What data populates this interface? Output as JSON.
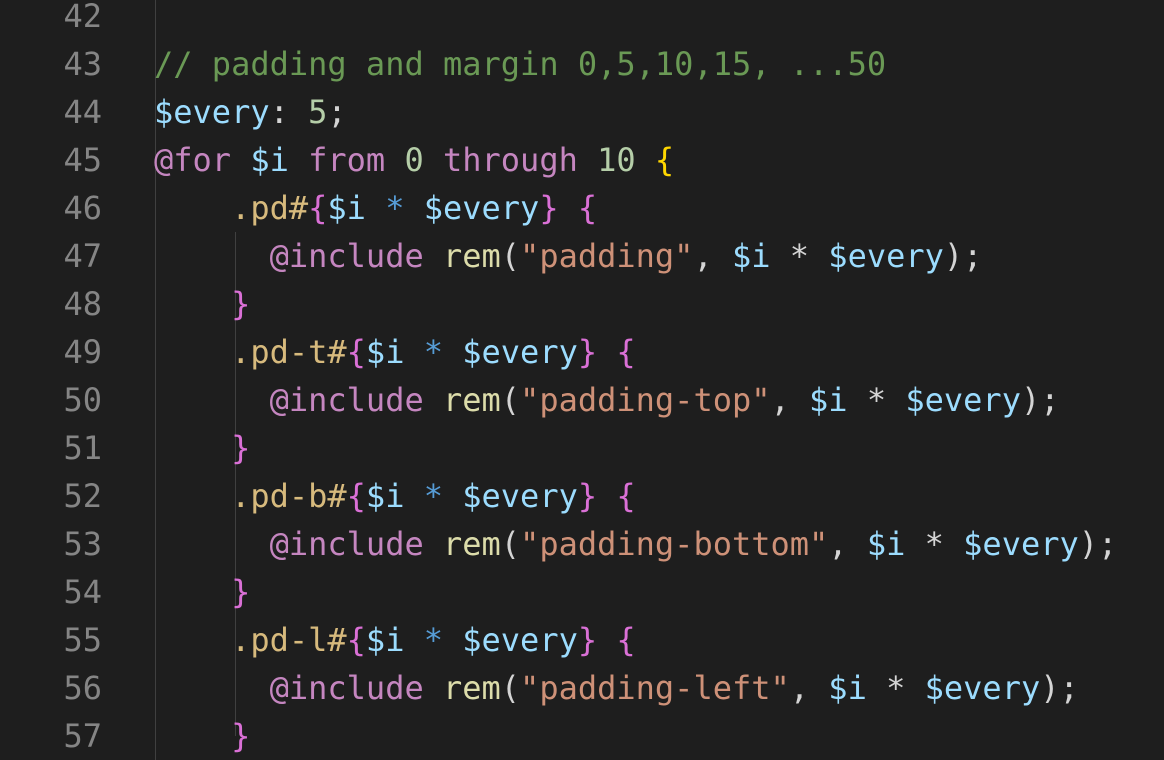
{
  "editor": {
    "colors": {
      "background": "#1e1e1e",
      "line_number": "#858585",
      "comment": "#6a9955",
      "variable": "#9cdcfe",
      "number": "#b5cea8",
      "keyword": "#c586c0",
      "bracket_level1": "#ffd700",
      "bracket_level2": "#da70d6",
      "selector": "#d7ba7d",
      "function": "#dcdcaa",
      "string": "#ce9178",
      "operator": "#569cd6"
    },
    "lines": [
      {
        "number": "42",
        "tokens": []
      },
      {
        "number": "43",
        "tokens": [
          {
            "text": "// padding and margin 0,5,10,15, ...50",
            "type": "comment"
          }
        ]
      },
      {
        "number": "44",
        "tokens": [
          {
            "text": "$every",
            "type": "var"
          },
          {
            "text": ": ",
            "type": "punc"
          },
          {
            "text": "5",
            "type": "num"
          },
          {
            "text": ";",
            "type": "punc"
          }
        ]
      },
      {
        "number": "45",
        "tokens": [
          {
            "text": "@for",
            "type": "kw"
          },
          {
            "text": " ",
            "type": "punc"
          },
          {
            "text": "$i",
            "type": "var"
          },
          {
            "text": " ",
            "type": "punc"
          },
          {
            "text": "from",
            "type": "kw"
          },
          {
            "text": " ",
            "type": "punc"
          },
          {
            "text": "0",
            "type": "num"
          },
          {
            "text": " ",
            "type": "punc"
          },
          {
            "text": "through",
            "type": "kw"
          },
          {
            "text": " ",
            "type": "punc"
          },
          {
            "text": "10",
            "type": "num"
          },
          {
            "text": " ",
            "type": "punc"
          },
          {
            "text": "{",
            "type": "brace"
          }
        ]
      },
      {
        "number": "46",
        "tokens": [
          {
            "text": "    ",
            "type": "punc"
          },
          {
            "text": ".pd#",
            "type": "sel"
          },
          {
            "text": "{",
            "type": "brace2"
          },
          {
            "text": "$i",
            "type": "var"
          },
          {
            "text": " ",
            "type": "punc"
          },
          {
            "text": "*",
            "type": "op"
          },
          {
            "text": " ",
            "type": "punc"
          },
          {
            "text": "$every",
            "type": "var"
          },
          {
            "text": "}",
            "type": "brace2"
          },
          {
            "text": " ",
            "type": "punc"
          },
          {
            "text": "{",
            "type": "brace2"
          }
        ]
      },
      {
        "number": "47",
        "tokens": [
          {
            "text": "      ",
            "type": "punc"
          },
          {
            "text": "@include",
            "type": "kw"
          },
          {
            "text": " ",
            "type": "punc"
          },
          {
            "text": "rem",
            "type": "fn"
          },
          {
            "text": "(",
            "type": "punc"
          },
          {
            "text": "\"padding\"",
            "type": "str"
          },
          {
            "text": ", ",
            "type": "punc"
          },
          {
            "text": "$i",
            "type": "var"
          },
          {
            "text": " * ",
            "type": "punc"
          },
          {
            "text": "$every",
            "type": "var"
          },
          {
            "text": ");",
            "type": "punc"
          }
        ]
      },
      {
        "number": "48",
        "tokens": [
          {
            "text": "    ",
            "type": "punc"
          },
          {
            "text": "}",
            "type": "brace2"
          }
        ]
      },
      {
        "number": "49",
        "tokens": [
          {
            "text": "    ",
            "type": "punc"
          },
          {
            "text": ".pd-t#",
            "type": "sel"
          },
          {
            "text": "{",
            "type": "brace2"
          },
          {
            "text": "$i",
            "type": "var"
          },
          {
            "text": " ",
            "type": "punc"
          },
          {
            "text": "*",
            "type": "op"
          },
          {
            "text": " ",
            "type": "punc"
          },
          {
            "text": "$every",
            "type": "var"
          },
          {
            "text": "}",
            "type": "brace2"
          },
          {
            "text": " ",
            "type": "punc"
          },
          {
            "text": "{",
            "type": "brace2"
          }
        ]
      },
      {
        "number": "50",
        "tokens": [
          {
            "text": "      ",
            "type": "punc"
          },
          {
            "text": "@include",
            "type": "kw"
          },
          {
            "text": " ",
            "type": "punc"
          },
          {
            "text": "rem",
            "type": "fn"
          },
          {
            "text": "(",
            "type": "punc"
          },
          {
            "text": "\"padding-top\"",
            "type": "str"
          },
          {
            "text": ", ",
            "type": "punc"
          },
          {
            "text": "$i",
            "type": "var"
          },
          {
            "text": " * ",
            "type": "punc"
          },
          {
            "text": "$every",
            "type": "var"
          },
          {
            "text": ");",
            "type": "punc"
          }
        ]
      },
      {
        "number": "51",
        "tokens": [
          {
            "text": "    ",
            "type": "punc"
          },
          {
            "text": "}",
            "type": "brace2"
          }
        ]
      },
      {
        "number": "52",
        "tokens": [
          {
            "text": "    ",
            "type": "punc"
          },
          {
            "text": ".pd-b#",
            "type": "sel"
          },
          {
            "text": "{",
            "type": "brace2"
          },
          {
            "text": "$i",
            "type": "var"
          },
          {
            "text": " ",
            "type": "punc"
          },
          {
            "text": "*",
            "type": "op"
          },
          {
            "text": " ",
            "type": "punc"
          },
          {
            "text": "$every",
            "type": "var"
          },
          {
            "text": "}",
            "type": "brace2"
          },
          {
            "text": " ",
            "type": "punc"
          },
          {
            "text": "{",
            "type": "brace2"
          }
        ]
      },
      {
        "number": "53",
        "tokens": [
          {
            "text": "      ",
            "type": "punc"
          },
          {
            "text": "@include",
            "type": "kw"
          },
          {
            "text": " ",
            "type": "punc"
          },
          {
            "text": "rem",
            "type": "fn"
          },
          {
            "text": "(",
            "type": "punc"
          },
          {
            "text": "\"padding-bottom\"",
            "type": "str"
          },
          {
            "text": ", ",
            "type": "punc"
          },
          {
            "text": "$i",
            "type": "var"
          },
          {
            "text": " * ",
            "type": "punc"
          },
          {
            "text": "$every",
            "type": "var"
          },
          {
            "text": ");",
            "type": "punc"
          }
        ]
      },
      {
        "number": "54",
        "tokens": [
          {
            "text": "    ",
            "type": "punc"
          },
          {
            "text": "}",
            "type": "brace2"
          }
        ]
      },
      {
        "number": "55",
        "tokens": [
          {
            "text": "    ",
            "type": "punc"
          },
          {
            "text": ".pd-l#",
            "type": "sel"
          },
          {
            "text": "{",
            "type": "brace2"
          },
          {
            "text": "$i",
            "type": "var"
          },
          {
            "text": " ",
            "type": "punc"
          },
          {
            "text": "*",
            "type": "op"
          },
          {
            "text": " ",
            "type": "punc"
          },
          {
            "text": "$every",
            "type": "var"
          },
          {
            "text": "}",
            "type": "brace2"
          },
          {
            "text": " ",
            "type": "punc"
          },
          {
            "text": "{",
            "type": "brace2"
          }
        ]
      },
      {
        "number": "56",
        "tokens": [
          {
            "text": "      ",
            "type": "punc"
          },
          {
            "text": "@include",
            "type": "kw"
          },
          {
            "text": " ",
            "type": "punc"
          },
          {
            "text": "rem",
            "type": "fn"
          },
          {
            "text": "(",
            "type": "punc"
          },
          {
            "text": "\"padding-left\"",
            "type": "str"
          },
          {
            "text": ", ",
            "type": "punc"
          },
          {
            "text": "$i",
            "type": "var"
          },
          {
            "text": " * ",
            "type": "punc"
          },
          {
            "text": "$every",
            "type": "var"
          },
          {
            "text": ");",
            "type": "punc"
          }
        ]
      },
      {
        "number": "57",
        "tokens": [
          {
            "text": "    ",
            "type": "punc"
          },
          {
            "text": "}",
            "type": "brace2"
          }
        ]
      }
    ]
  }
}
